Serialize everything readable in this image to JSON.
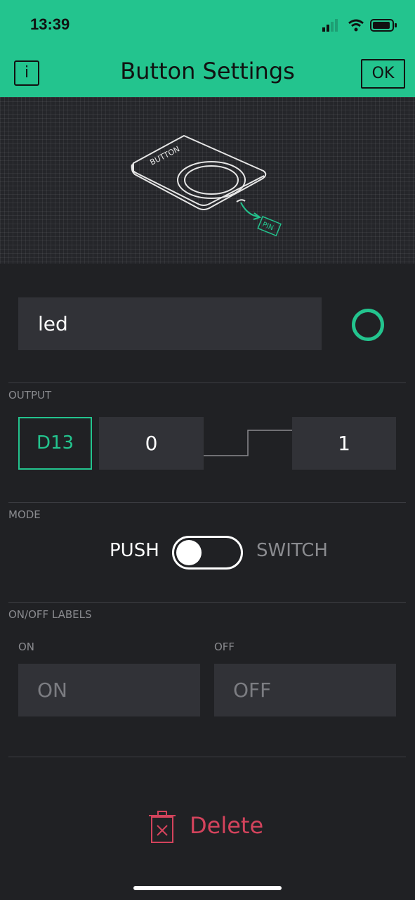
{
  "status_bar": {
    "time": "13:39"
  },
  "header": {
    "title": "Button Settings",
    "info_label": "i",
    "ok_label": "OK"
  },
  "preview": {
    "button_caption": "BUTTON",
    "pin_caption": "PIN"
  },
  "widget": {
    "name_value": "led",
    "color": "#23c48e"
  },
  "output": {
    "section_label": "OUTPUT",
    "pin": "D13",
    "low_value": "0",
    "high_value": "1"
  },
  "mode": {
    "section_label": "MODE",
    "push_label": "PUSH",
    "switch_label": "SWITCH",
    "selected": "PUSH"
  },
  "labels": {
    "section_label": "ON/OFF LABELS",
    "on_caption": "ON",
    "off_caption": "OFF",
    "on_placeholder": "ON",
    "off_placeholder": "OFF"
  },
  "footer": {
    "delete_label": "Delete"
  },
  "colors": {
    "accent": "#23c48e",
    "danger": "#d3435c",
    "background": "#202124"
  }
}
